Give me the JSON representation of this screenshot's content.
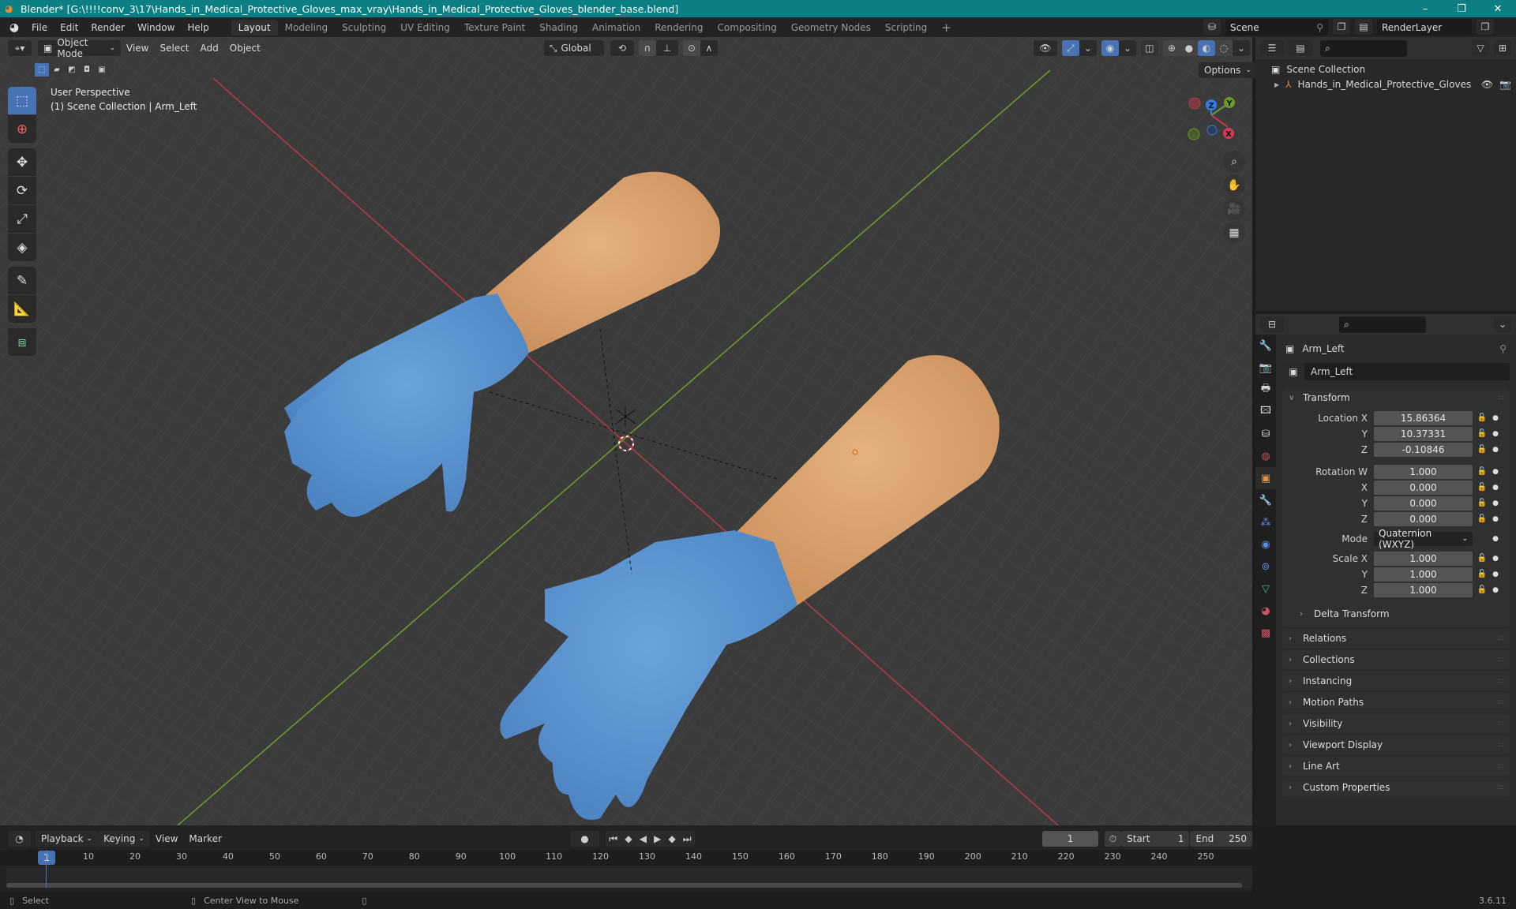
{
  "window": {
    "title": "Blender* [G:\\!!!!conv_3\\17\\Hands_in_Medical_Protective_Gloves_max_vray\\Hands_in_Medical_Protective_Gloves_blender_base.blend]",
    "minimize": "–",
    "maximize": "❐",
    "close": "✕"
  },
  "menubar": {
    "items": [
      "File",
      "Edit",
      "Render",
      "Window",
      "Help"
    ],
    "workspaces": [
      "Layout",
      "Modeling",
      "Sculpting",
      "UV Editing",
      "Texture Paint",
      "Shading",
      "Animation",
      "Rendering",
      "Compositing",
      "Geometry Nodes",
      "Scripting"
    ],
    "active_workspace": "Layout",
    "add_workspace": "+",
    "scene": "Scene",
    "view_layer": "RenderLayer"
  },
  "viewport_header": {
    "mode": "Object Mode",
    "menus": [
      "View",
      "Select",
      "Add",
      "Object"
    ],
    "transform_orientation": "Global",
    "options": "Options"
  },
  "viewport": {
    "view_name": "User Perspective",
    "collection_info": "(1) Scene Collection | Arm_Left",
    "axis_labels": {
      "x": "X",
      "y": "Y",
      "z": "Z"
    },
    "colors": {
      "x_axis": "#c1384a",
      "y_axis": "#6a9a2a",
      "z_axis": "#2f7fe0",
      "glove": "#5e97d4",
      "skin": "#d9a06e"
    }
  },
  "outliner": {
    "search_placeholder": "",
    "root": "Scene Collection",
    "items": [
      {
        "name": "Hands_in_Medical_Protective_Gloves",
        "icon": "armature-icon"
      }
    ]
  },
  "properties": {
    "object_name": "Arm_Left",
    "data_name": "Arm_Left",
    "transform": {
      "title": "Transform",
      "location": {
        "label": "Location X",
        "x": "15.86364",
        "y": "10.37331",
        "z": "-0.10846"
      },
      "rotation": {
        "label": "Rotation W",
        "w": "1.000",
        "x": "0.000",
        "y": "0.000",
        "z": "0.000"
      },
      "mode_label": "Mode",
      "mode": "Quaternion (WXYZ)",
      "scale": {
        "label": "Scale X",
        "x": "1.000",
        "y": "1.000",
        "z": "1.000"
      },
      "axis_y": "Y",
      "axis_z": "Z",
      "axis_x": "X",
      "delta": "Delta Transform"
    },
    "panels": [
      "Relations",
      "Collections",
      "Instancing",
      "Motion Paths",
      "Visibility",
      "Viewport Display",
      "Line Art",
      "Custom Properties"
    ]
  },
  "timeline": {
    "menus": [
      "Playback",
      "Keying",
      "View",
      "Marker"
    ],
    "current_frame": "1",
    "start_label": "Start",
    "start": "1",
    "end_label": "End",
    "end": "250",
    "ticks": [
      "10",
      "20",
      "30",
      "40",
      "50",
      "60",
      "70",
      "80",
      "90",
      "100",
      "110",
      "120",
      "130",
      "140",
      "150",
      "160",
      "170",
      "180",
      "190",
      "200",
      "210",
      "220",
      "230",
      "240",
      "250"
    ]
  },
  "statusbar": {
    "select": "Select",
    "center_view": "Center View to Mouse",
    "version": "3.6.11"
  }
}
